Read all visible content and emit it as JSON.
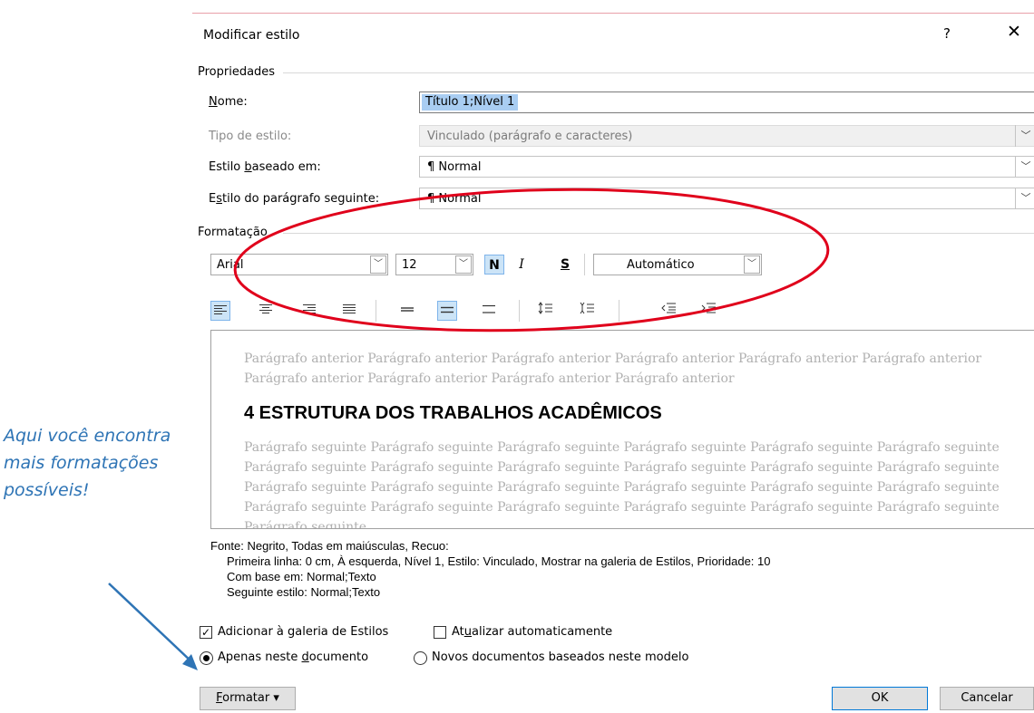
{
  "dialog": {
    "title": "Modificar estilo",
    "help": "?",
    "close": "✕"
  },
  "properties": {
    "group_label": "Propriedades",
    "name_label_pre": "",
    "name_label_key": "N",
    "name_label_post": "ome:",
    "name_value": "Título 1;Nível 1",
    "type_label": "Tipo de estilo:",
    "type_value": "Vinculado (parágrafo e caracteres)",
    "based_label_pre": "Estilo ",
    "based_label_key": "b",
    "based_label_post": "aseado em:",
    "based_value": "¶ Normal",
    "next_label_pre": "E",
    "next_label_key": "s",
    "next_label_post": "tilo do parágrafo seguinte:",
    "next_value": "¶ Normal"
  },
  "formatting": {
    "group_label": "Formatação",
    "font": "Arial",
    "size": "12",
    "bold": "N",
    "italic": "I",
    "underline": "S",
    "color": "Automático"
  },
  "preview": {
    "previous_text": "Parágrafo anterior Parágrafo anterior Parágrafo anterior Parágrafo anterior Parágrafo anterior Parágrafo anterior Parágrafo anterior Parágrafo anterior Parágrafo anterior Parágrafo anterior",
    "heading": "4 ESTRUTURA DOS TRABALHOS ACADÊMICOS",
    "following_text": "Parágrafo seguinte Parágrafo seguinte Parágrafo seguinte Parágrafo seguinte Parágrafo seguinte Parágrafo seguinte Parágrafo seguinte Parágrafo seguinte Parágrafo seguinte Parágrafo seguinte Parágrafo seguinte Parágrafo seguinte Parágrafo seguinte Parágrafo seguinte Parágrafo seguinte Parágrafo seguinte Parágrafo seguinte Parágrafo seguinte Parágrafo seguinte Parágrafo seguinte Parágrafo seguinte Parágrafo seguinte Parágrafo seguinte Parágrafo seguinte Parágrafo seguinte"
  },
  "description": {
    "line1": "Fonte: Negrito, Todas em maiúsculas, Recuo:",
    "line2": "Primeira linha:  0 cm, À esquerda, Nível 1, Estilo: Vinculado, Mostrar na galeria de Estilos, Prioridade: 10",
    "line3": "Com base em: Normal;Texto",
    "line4": "Seguinte estilo: Normal;Texto"
  },
  "options": {
    "add_gallery": "Adicionar à galeria de Estilos",
    "add_gallery_checked": true,
    "auto_update_pre": "At",
    "auto_update_key": "u",
    "auto_update_post": "alizar automaticamente",
    "auto_update_checked": false,
    "only_doc_pre": "Apenas neste ",
    "only_doc_key": "d",
    "only_doc_post": "ocumento",
    "new_docs": "Novos documentos baseados neste modelo"
  },
  "buttons": {
    "format_key": "F",
    "format_rest": "ormatar",
    "ok": "OK",
    "cancel": "Cancelar"
  },
  "annotation": {
    "text": "Aqui você encontra mais formatações possíveis!",
    "color": "#2e74b5"
  },
  "highlight_color": "#e0001b"
}
